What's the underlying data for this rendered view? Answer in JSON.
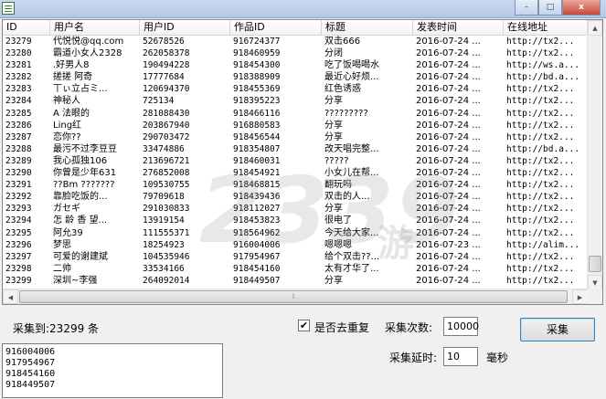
{
  "window": {
    "minimize": "–",
    "maximize": "□",
    "close": "x"
  },
  "table": {
    "columns": [
      "ID",
      "用户名",
      "用户ID",
      "作品ID",
      "标题",
      "发表时间",
      "在线地址"
    ],
    "rows": [
      [
        "23279",
        "代悦悦@qq.com",
        "52678526",
        "916724377",
        "双击666",
        "2016-07-24 ...",
        "http://tx2..."
      ],
      [
        "23280",
        "霸道小女人2328",
        "262058378",
        "918460959",
        "分闭",
        "2016-07-24 ...",
        "http://tx2..."
      ],
      [
        "23281",
        ".好男人8",
        "190494228",
        "918454300",
        "吃了饭喝喝水",
        "2016-07-24 ...",
        "http://ws.a..."
      ],
      [
        "23282",
        "搓搓  阿奇",
        "17777684",
        "918388909",
        "最近心好烦...",
        "2016-07-24 ...",
        "http://bd.a..."
      ],
      [
        "23283",
        "丅ぃ立占ミ...",
        "120694370",
        "918455369",
        "红色诱惑",
        "2016-07-24 ...",
        "http://tx2..."
      ],
      [
        "23284",
        "神秘人",
        "725134",
        "918395223",
        "分享",
        "2016-07-24 ...",
        "http://tx2..."
      ],
      [
        "23285",
        "A  法眼的",
        "281088430",
        "918466116",
        "?????????",
        "2016-07-24 ...",
        "http://tx2..."
      ],
      [
        "23286",
        "Ling红",
        "203867940",
        "916880583",
        "分享",
        "2016-07-24 ...",
        "http://tx2..."
      ],
      [
        "23287",
        "恋你??",
        "290703472",
        "918456544",
        "分享",
        "2016-07-24 ...",
        "http://tx2..."
      ],
      [
        "23288",
        "最污不过李豆豆",
        "33474886",
        "918354807",
        "改天唱完整...",
        "2016-07-24 ...",
        "http://bd.a..."
      ],
      [
        "23289",
        "我心孤独106",
        "213696721",
        "918460031",
        "?????",
        "2016-07-24 ...",
        "http://tx2..."
      ],
      [
        "23290",
        "你曾是少年631",
        "276852008",
        "918454921",
        "小女儿在帮...",
        "2016-07-24 ...",
        "http://tx2..."
      ],
      [
        "23291",
        "??Bm ???????",
        "109530755",
        "918468815",
        "翻玩吗",
        "2016-07-24 ...",
        "http://tx2..."
      ],
      [
        "23292",
        "靠脸吃饭的...",
        "79709618",
        "918439436",
        "双击的人...",
        "2016-07-24 ...",
        "http://tx2..."
      ],
      [
        "23293",
        "ガセギ",
        "291030833",
        "918112027",
        "分享",
        "2016-07-24 ...",
        "http://tx2..."
      ],
      [
        "23294",
        "怎 龄 香 望...",
        "13919154",
        "918453823",
        "很电了",
        "2016-07-24 ...",
        "http://tx2..."
      ],
      [
        "23295",
        "阿允39",
        "111555371",
        "918564962",
        "今天给大家...",
        "2016-07-24 ...",
        "http://tx2..."
      ],
      [
        "23296",
        "梦思",
        "18254923",
        "916004006",
        "嗯嗯嗯",
        "2016-07-23 ...",
        "http://alim..."
      ],
      [
        "23297",
        "可爱的谢建斌",
        "104535946",
        "917954967",
        "给个双击??...",
        "2016-07-24 ...",
        "http://tx2..."
      ],
      [
        "23298",
        "二帅",
        "33534166",
        "918454160",
        "太有才华了...",
        "2016-07-24 ...",
        "http://tx2..."
      ],
      [
        "23299",
        "深圳~李强",
        "264092014",
        "918449507",
        "分享",
        "2016-07-24 ...",
        "http://tx2..."
      ]
    ]
  },
  "status": {
    "collected_label": "采集到:23299 条"
  },
  "options": {
    "dedupe_label": "是否去重复",
    "dedupe_checked": "✔",
    "count_label": "采集次数:",
    "count_value": "10000",
    "delay_label": "采集延时:",
    "delay_value": "10",
    "delay_unit": "毫秒"
  },
  "collect_button": "采集",
  "log_lines": [
    "916004006",
    "917954967",
    "918454160",
    "918449507"
  ],
  "watermark": {
    "main": "2339",
    "sub": "游"
  }
}
